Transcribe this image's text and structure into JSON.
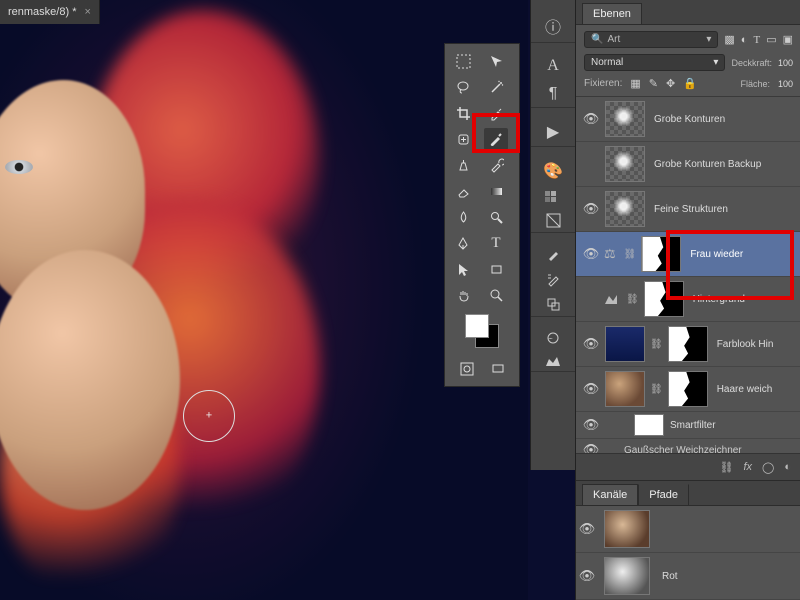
{
  "document": {
    "tab_title": "renmaske/8) *"
  },
  "panels": {
    "layers_tab": "Ebenen",
    "channels_tab": "Kanäle",
    "paths_tab": "Pfade"
  },
  "layer_controls": {
    "search_value": "Art",
    "blend_mode": "Normal",
    "opacity_label": "Deckkraft:",
    "opacity_value": "100",
    "lock_label": "Fixieren:",
    "fill_label": "Fläche:",
    "fill_value": "100"
  },
  "layers": [
    {
      "name": "Grobe Konturen"
    },
    {
      "name": "Grobe Konturen Backup"
    },
    {
      "name": "Feine Strukturen"
    },
    {
      "name": "Frau wieder",
      "selected": true
    },
    {
      "name": "Hintergrund"
    },
    {
      "name": "Farblook Hin"
    },
    {
      "name": "Haare weich"
    }
  ],
  "smartfilter": {
    "label": "Smartfilter",
    "items": [
      "Gaußscher Weichzeichner"
    ]
  },
  "channels": [
    {
      "name": ""
    },
    {
      "name": "Rot"
    }
  ]
}
